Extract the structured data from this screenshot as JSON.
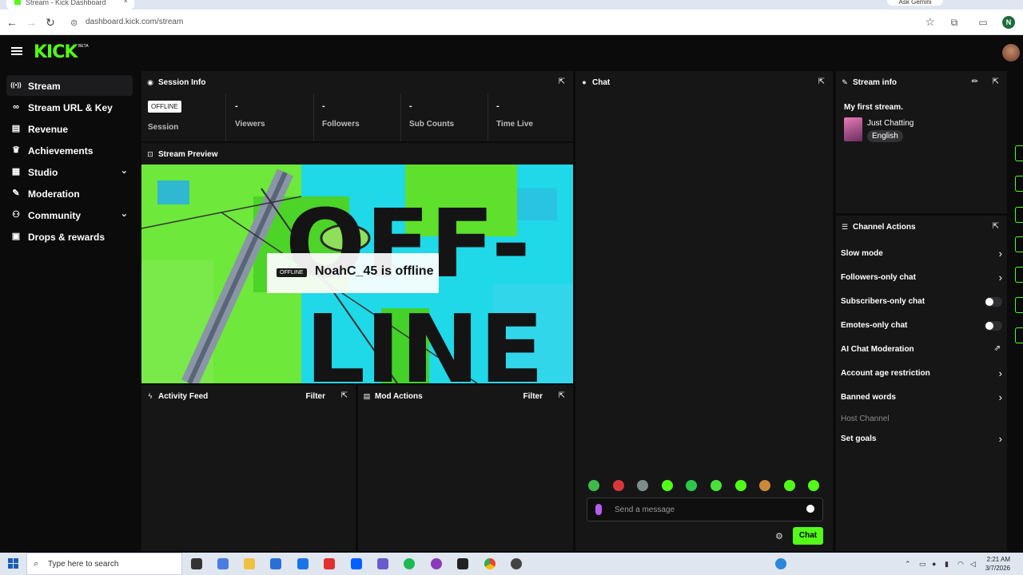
{
  "browser": {
    "tab_title": "Stream - Kick Dashboard",
    "tab_close": "×",
    "new_tab": "+",
    "gemini": "Ask Gemini",
    "url": "dashboard.kick.com/stream",
    "profile_initial": "N"
  },
  "header": {
    "logo": "KICK",
    "beta": "BETA"
  },
  "sidebar": {
    "items": [
      {
        "label": "Stream",
        "icon": "broadcast-icon",
        "glyph": "((•))"
      },
      {
        "label": "Stream URL & Key",
        "icon": "link-icon",
        "glyph": "🔗"
      },
      {
        "label": "Revenue",
        "icon": "chart-icon",
        "glyph": "▤"
      },
      {
        "label": "Achievements",
        "icon": "trophy-icon",
        "glyph": "🏆"
      },
      {
        "label": "Studio",
        "icon": "studio-icon",
        "glyph": "▦"
      },
      {
        "label": "Moderation",
        "icon": "wrench-icon",
        "glyph": "🔧"
      },
      {
        "label": "Community",
        "icon": "community-icon",
        "glyph": "👥"
      },
      {
        "label": "Drops & rewards",
        "icon": "gift-icon",
        "glyph": "🎁"
      }
    ]
  },
  "session_info": {
    "title": "Session Info",
    "status_badge": "OFFLINE",
    "session_label": "Session",
    "stats": [
      {
        "value": "-",
        "label": "Viewers"
      },
      {
        "value": "-",
        "label": "Followers"
      },
      {
        "value": "-",
        "label": "Sub Counts"
      },
      {
        "value": "-",
        "label": "Time Live"
      }
    ]
  },
  "preview": {
    "title": "Stream Preview",
    "overlay_badge": "OFFLINE",
    "overlay_text": "NoahC_45 is offline",
    "art_text_1": "OFF-",
    "art_text_2": "LINE"
  },
  "activity_feed": {
    "title": "Activity Feed",
    "filter": "Filter"
  },
  "mod_actions": {
    "title": "Mod Actions",
    "filter": "Filter"
  },
  "chat": {
    "title": "Chat",
    "placeholder": "Send a message",
    "send_label": "Chat",
    "emote_colors": [
      "#3fb94a",
      "#d8383a",
      "#7c8c8a",
      "#53fc18",
      "#2cc84a",
      "#4de03c",
      "#53fc18",
      "#c98a3a",
      "#53fc18",
      "#53fc18"
    ]
  },
  "stream_info": {
    "title": "Stream info",
    "stream_title": "My first stream.",
    "category": "Just Chatting",
    "language": "English"
  },
  "channel_actions": {
    "title": "Channel Actions",
    "rows": [
      {
        "label": "Slow mode",
        "type": "chevron"
      },
      {
        "label": "Followers-only chat",
        "type": "chevron"
      },
      {
        "label": "Subscribers-only chat",
        "type": "toggle",
        "on": false
      },
      {
        "label": "Emotes-only chat",
        "type": "toggle",
        "on": false
      },
      {
        "label": "AI Chat Moderation",
        "type": "external"
      },
      {
        "label": "Account age restriction",
        "type": "chevron"
      },
      {
        "label": "Banned words",
        "type": "chevron"
      },
      {
        "label": "Host Channel",
        "type": "disabled"
      },
      {
        "label": "Set goals",
        "type": "chevron"
      }
    ]
  },
  "taskbar": {
    "search_placeholder": "Type here to search",
    "time": "2:21 AM",
    "date": "3/7/2026"
  },
  "colors": {
    "accent": "#53fc18",
    "panel": "#161617",
    "background": "#0b0b0c"
  }
}
